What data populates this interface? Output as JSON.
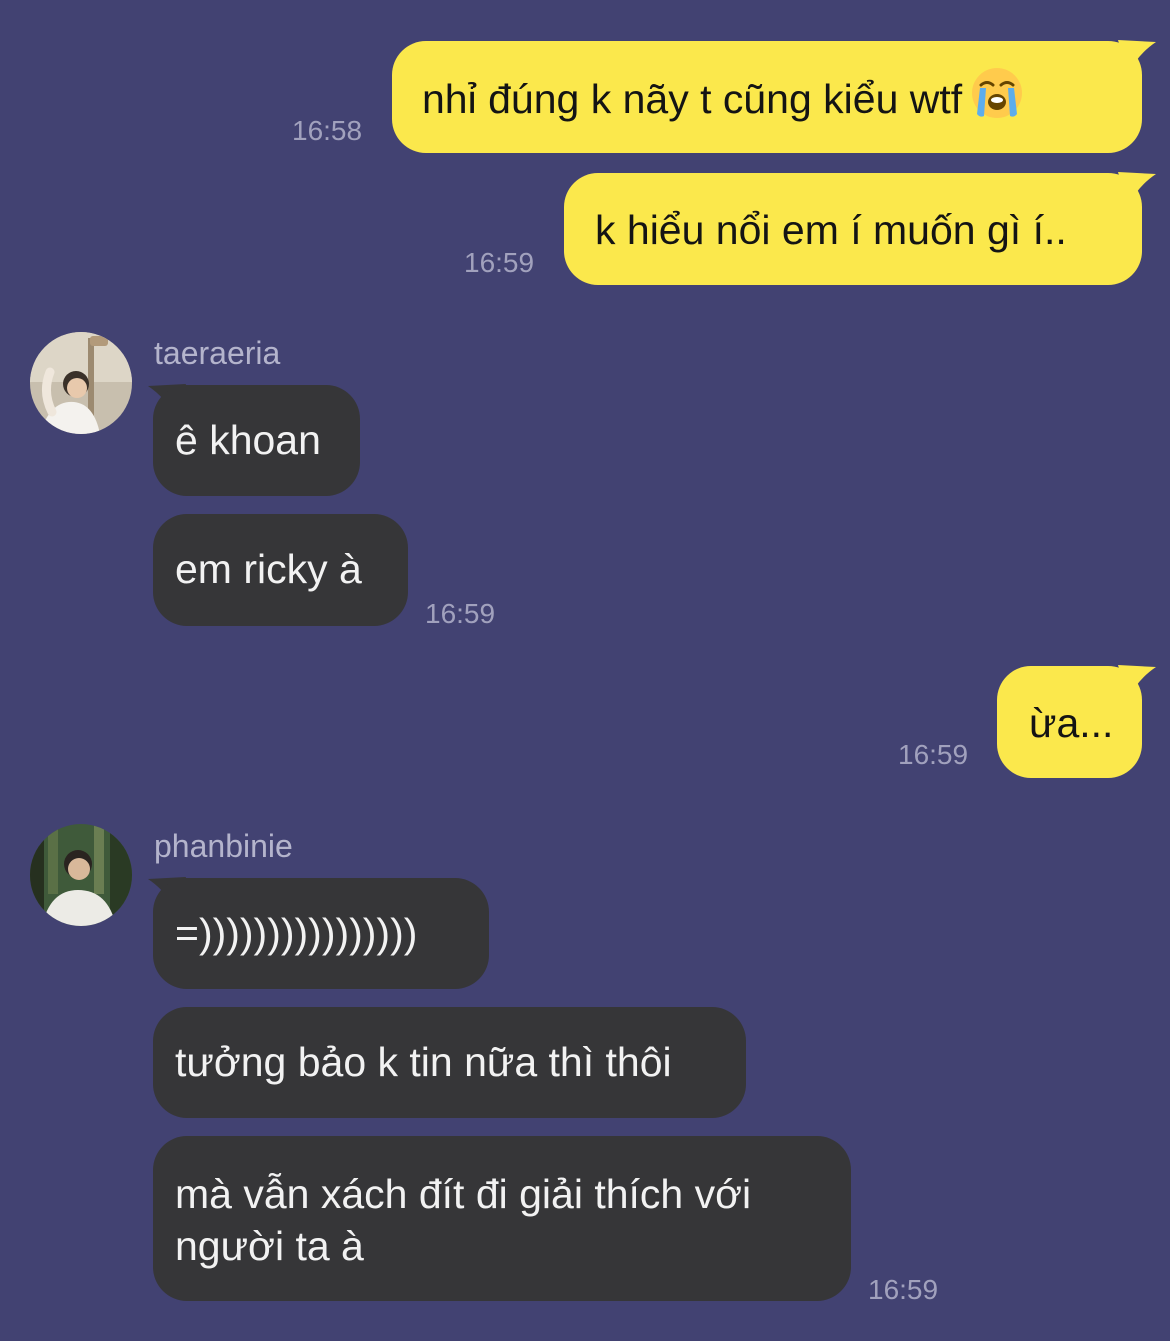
{
  "messages": {
    "out1": {
      "text": "nhỉ đúng k nãy t cũng kiểu wtf",
      "time": "16:58",
      "emoji": "loudly-crying-face-emoji"
    },
    "out2": {
      "text": "k hiểu nổi em í muốn gì í..",
      "time": "16:59"
    },
    "group1": {
      "sender": "taeraeria",
      "msg1": "ê khoan",
      "msg2": "em ricky à",
      "time": "16:59"
    },
    "out3": {
      "text": "ừa...",
      "time": "16:59"
    },
    "group2": {
      "sender": "phanbinie",
      "msg1": "=))))))))))))))))",
      "msg2": "tưởng bảo k tin nữa thì thôi",
      "msg3_line1": "mà vẫn xách đít đi giải thích với",
      "msg3_line2": "người ta à",
      "time": "16:59"
    }
  },
  "colors": {
    "background": "#424272",
    "outgoing_bubble": "#fbe84c",
    "incoming_bubble": "#363638",
    "timestamp": "#a1a1bd"
  }
}
